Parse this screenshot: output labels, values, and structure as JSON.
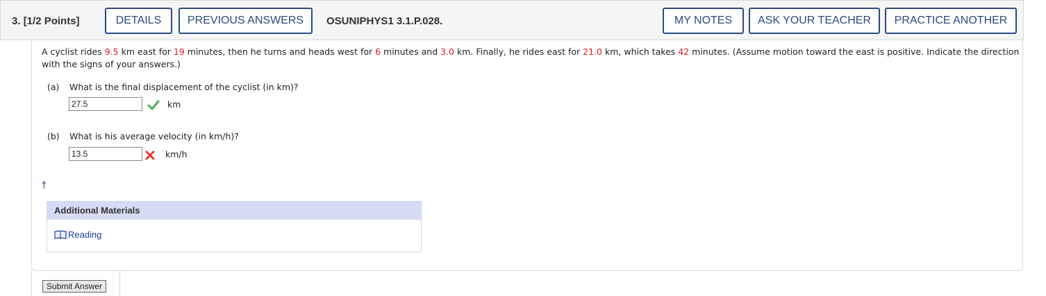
{
  "header": {
    "question_number": "3.",
    "points": "[1/2 Points]",
    "details_label": "DETAILS",
    "previous_answers_label": "PREVIOUS ANSWERS",
    "question_id": "OSUNIPHYS1 3.1.P.028.",
    "my_notes_label": "MY NOTES",
    "ask_teacher_label": "ASK YOUR TEACHER",
    "practice_another_label": "PRACTICE ANOTHER"
  },
  "prompt": {
    "t1": "A cyclist rides ",
    "v1": "9.5",
    "t2": " km east for ",
    "v2": "19",
    "t3": " minutes, then he turns and heads west for ",
    "v3": "6",
    "t4": " minutes and ",
    "v4": "3.0",
    "t5": " km. Finally, he rides east for ",
    "v5": "21.0",
    "t6": " km, which takes ",
    "v6": "42",
    "t7": " minutes. (Assume motion toward the east is positive. Indicate the direction with the signs of your answers.)"
  },
  "parts": [
    {
      "label": "(a)",
      "question": "What is the final displacement of the cyclist (in km)?",
      "answer": "27.5",
      "unit": "km",
      "status": "correct"
    },
    {
      "label": "(b)",
      "question": "What is his average velocity (in km/h)?",
      "answer": "13.5",
      "unit": "km/h",
      "status": "incorrect"
    }
  ],
  "footnote_mark": "†",
  "additional_materials": {
    "title": "Additional Materials",
    "reading_label": "Reading",
    "icon": "book-icon"
  },
  "submit_label": "Submit Answer",
  "colors": {
    "accent": "#2b4a7e",
    "value_red": "#d81b1b",
    "correct_green": "#4caf50",
    "incorrect_red": "#e53935",
    "panel_header": "#d6dcf5"
  }
}
